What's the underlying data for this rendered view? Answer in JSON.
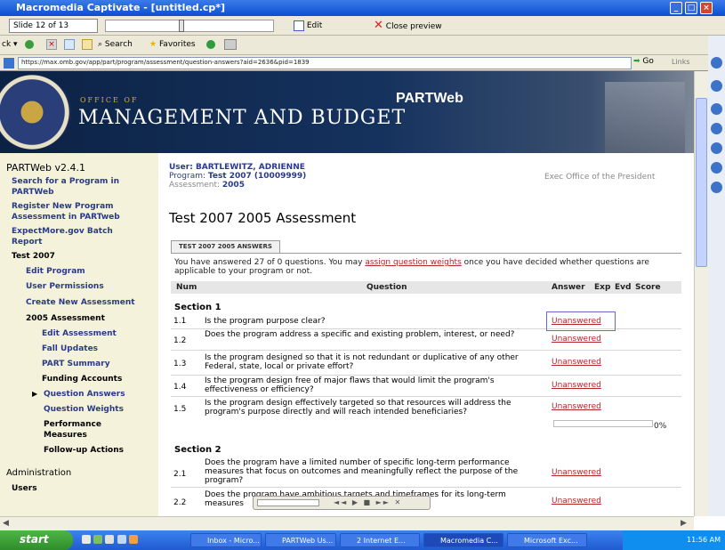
{
  "window": {
    "title": "Macromedia Captivate - [untitled.cp*]"
  },
  "captivate": {
    "slide_label": "Slide 12 of 13",
    "edit_label": "Edit",
    "close_label": "Close preview"
  },
  "browser": {
    "back_label": "ck",
    "search_label": "Search",
    "favorites_label": "Favorites",
    "address": "https://max.omb.gov/app/part/program/assessment/question-answers?aid=2636&pid=1839",
    "go_label": "Go",
    "links_label": "Links"
  },
  "banner": {
    "office_of": "OFFICE OF",
    "title": "MANAGEMENT AND BUDGET",
    "product": "PARTWeb"
  },
  "sidebar": {
    "version": "PARTWeb v2.4.1",
    "items": [
      {
        "label": "Search for a Program in"
      },
      {
        "label": "PARTWeb"
      },
      {
        "label": "Register New Program"
      },
      {
        "label": "Assessment in PARTweb"
      },
      {
        "label": "ExpectMore.gov Batch"
      },
      {
        "label": "Report"
      },
      {
        "label": "Test 2007"
      },
      {
        "label": "Edit Program"
      },
      {
        "label": "User Permissions"
      },
      {
        "label": "Create New Assessment"
      },
      {
        "label": "2005 Assessment"
      },
      {
        "label": "Edit Assessment"
      },
      {
        "label": "Fall Updates"
      },
      {
        "label": "PART Summary"
      },
      {
        "label": "Funding Accounts"
      },
      {
        "label": "Question Answers"
      },
      {
        "label": "Question Weights"
      },
      {
        "label": "Performance"
      },
      {
        "label": "Measures"
      },
      {
        "label": "Follow-up Actions"
      },
      {
        "label": "Administration"
      },
      {
        "label": "Users"
      }
    ]
  },
  "header": {
    "user_label": "User: BARTLEWITZ, ADRIENNE",
    "program_label": "Program:",
    "program_value": "Test 2007 (10009999)",
    "assessment_label": "Assessment:",
    "assessment_value": "2005",
    "org": "Exec Office of the President"
  },
  "page": {
    "title": "Test 2007 2005 Assessment",
    "tab": "TEST 2007 2005 ANSWERS",
    "intro_before": "You have answered 27 of 0 questions. You may ",
    "intro_link": "assign question weights",
    "intro_after": " once you have decided whether questions are applicable to your program or not."
  },
  "table": {
    "headers": {
      "num": "Num",
      "question": "Question",
      "answer": "Answer",
      "exp": "Exp",
      "evd": "Evd",
      "score": "Score"
    },
    "section1": "Section 1",
    "section2": "Section 2",
    "rows": [
      {
        "num": "1.1",
        "q": "Is the program purpose clear?",
        "a": "Unanswered"
      },
      {
        "num": "1.2",
        "q": "Does the program address a specific and existing problem, interest, or need?",
        "a": "Unanswered"
      },
      {
        "num": "1.3",
        "q": "Is the program designed so that it is not redundant or duplicative of any other Federal, state, local or private effort?",
        "a": "Unanswered"
      },
      {
        "num": "1.4",
        "q": "Is the program design free of major flaws that would limit the program's effectiveness or efficiency?",
        "a": "Unanswered"
      },
      {
        "num": "1.5",
        "q": "Is the program design effectively targeted so that resources will address the program's purpose directly and will reach intended beneficiaries?",
        "a": "Unanswered"
      },
      {
        "num": "2.1",
        "q": "Does the program have a limited number of specific long-term performance measures that focus on outcomes and meaningfully reflect the purpose of the program?",
        "a": "Unanswered"
      },
      {
        "num": "2.2",
        "q": "Does the program have ambitious targets and timeframes for its long-term measures",
        "a": "Unanswered"
      }
    ],
    "score_pct": "0%"
  },
  "taskbar": {
    "start": "start",
    "tasks": [
      "Inbox - Micro...",
      "PARTWeb Us...",
      "2 Internet E...",
      "Macromedia C...",
      "Microsoft Exc..."
    ],
    "time": "11:56 AM"
  }
}
